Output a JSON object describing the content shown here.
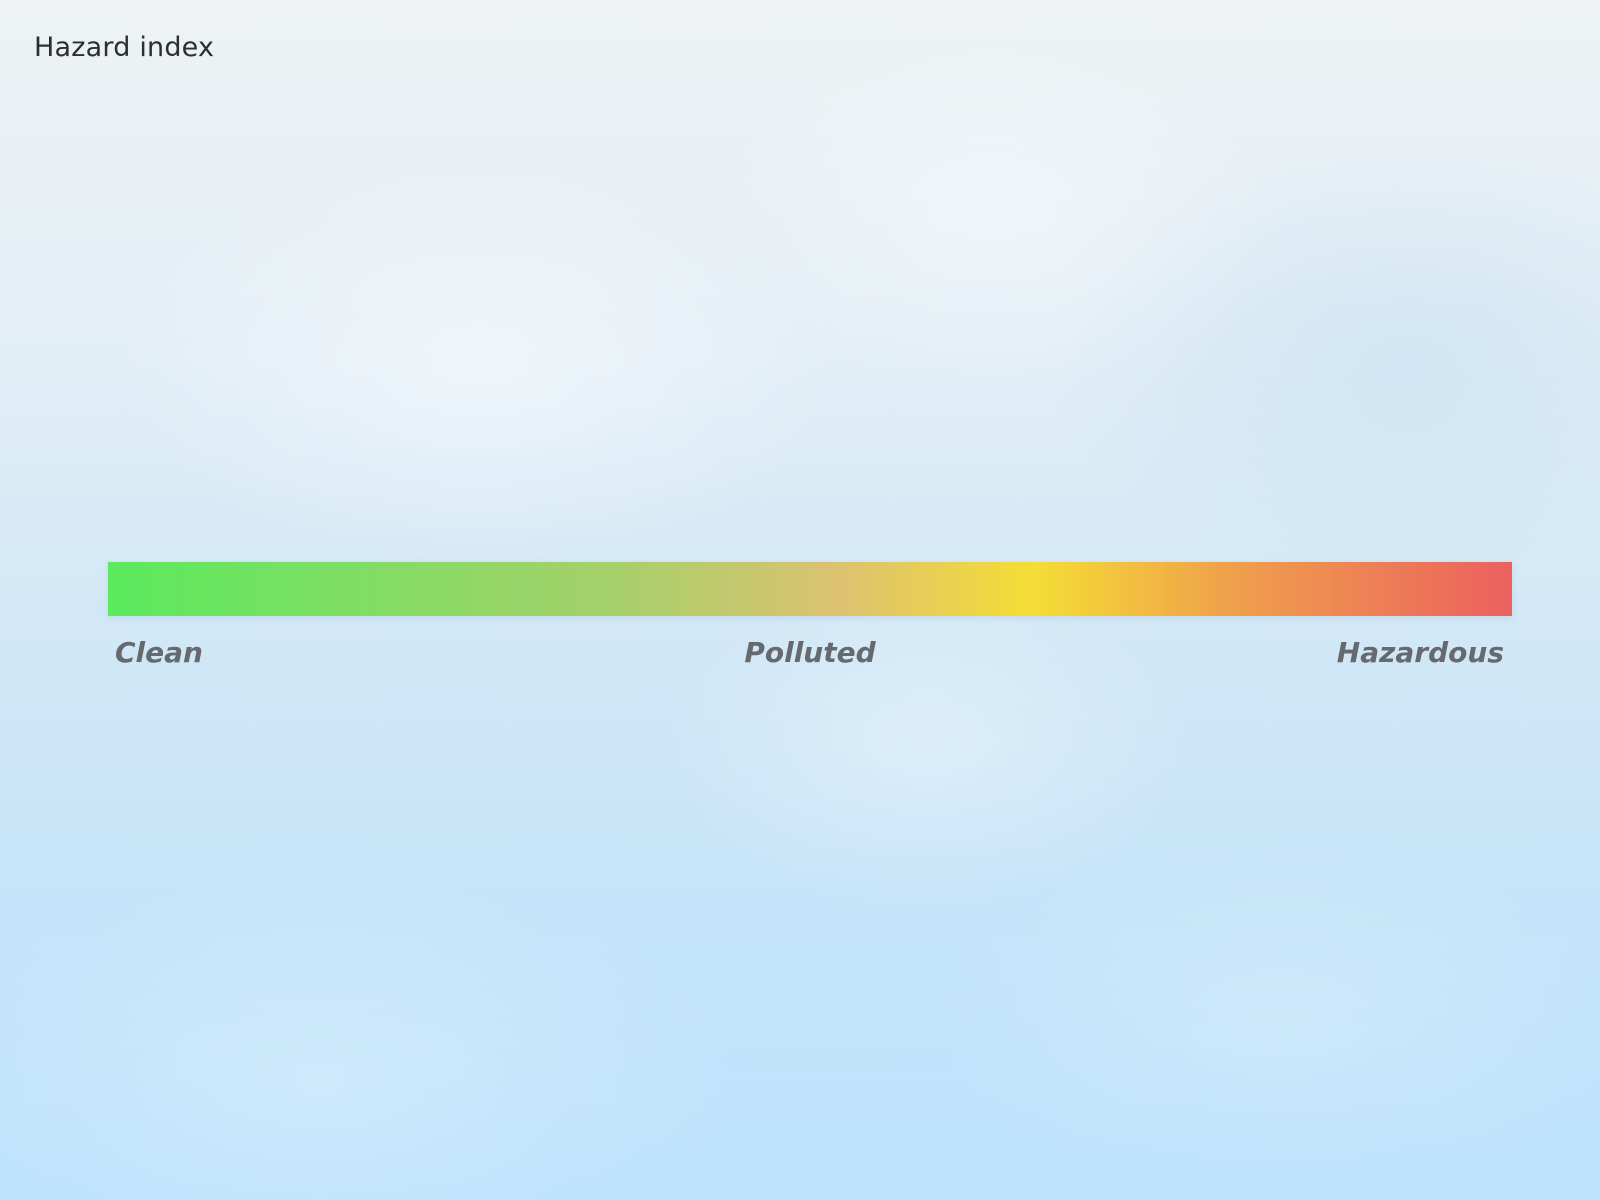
{
  "title": "Hazard index",
  "scale": {
    "labels": {
      "low": "Clean",
      "mid": "Polluted",
      "high": "Hazardous"
    },
    "colors": {
      "clean": "#5bea5e",
      "mid_green": "#a6d06a",
      "polluted": "#dcc271",
      "yellow": "#f5dd35",
      "orange": "#efa04b",
      "hazardous": "#ec6060"
    }
  }
}
